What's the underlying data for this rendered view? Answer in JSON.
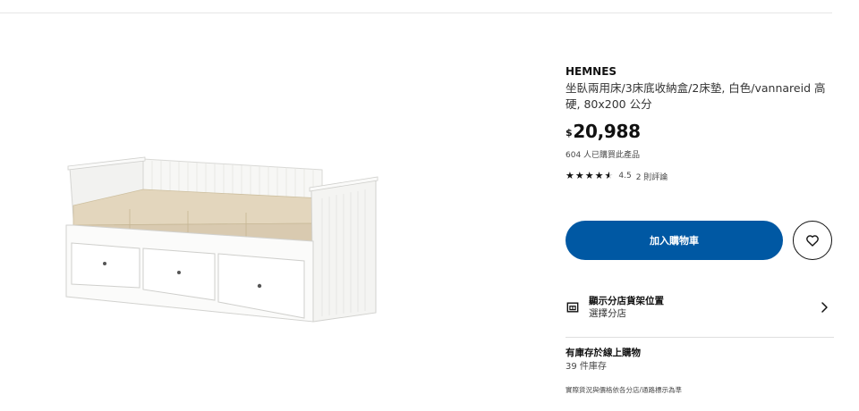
{
  "product": {
    "brand": "HEMNES",
    "description": "坐臥兩用床/3床底收納盒/2床墊, 白色/vannareid 高硬, 80x200 公分",
    "price_currency": "$",
    "price_value": "20,988",
    "bought_text": "604 人已購買此產品",
    "rating_value": "4.5",
    "rating_stars": 4.5,
    "review_count": "2 則評論",
    "image_icon": "daybed-image"
  },
  "actions": {
    "add_to_cart_label": "加入購物車",
    "favorite_icon": "heart-icon",
    "cart_color": "#0058a3"
  },
  "store": {
    "title": "顯示分店貨架位置",
    "subtitle": "選擇分店",
    "icon": "store-icon",
    "chevron_icon": "chevron-right-icon"
  },
  "stock": {
    "title": "有庫存於線上購物",
    "count": "39 件庫存",
    "disclaimer": "實際貨況與價格依各分店/通路標示為準"
  }
}
